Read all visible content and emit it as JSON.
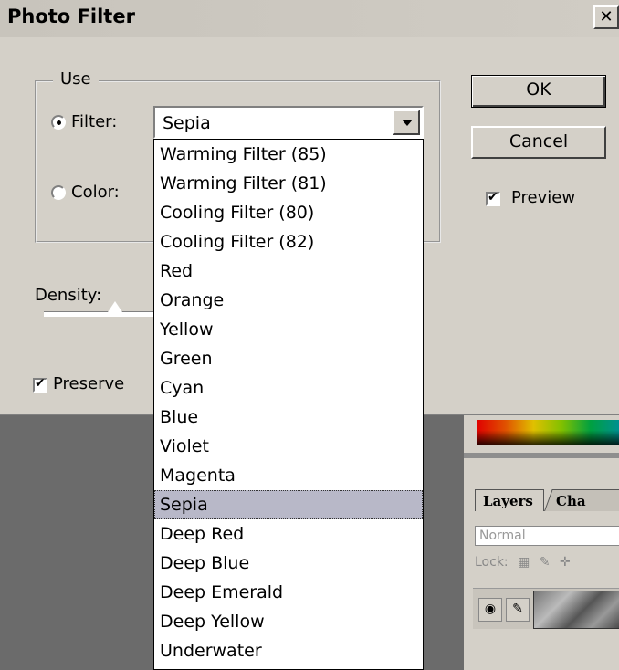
{
  "dialog": {
    "title": "Photo Filter",
    "close_glyph": "✕",
    "use_group_label": "Use",
    "filter_label": "Filter:",
    "color_label": "Color:",
    "selected_filter": "Sepia",
    "density_label": "Density:",
    "preserve_label": "Preserve",
    "ok_label": "OK",
    "cancel_label": "Cancel",
    "preview_label": "Preview",
    "filter_radio_checked": true,
    "preview_checked": true,
    "preserve_checked": true
  },
  "filter_options": [
    "Warming Filter (85)",
    "Warming Filter (81)",
    "Cooling Filter (80)",
    "Cooling Filter (82)",
    "Red",
    "Orange",
    "Yellow",
    "Green",
    "Cyan",
    "Blue",
    "Violet",
    "Magenta",
    "Sepia",
    "Deep Red",
    "Deep Blue",
    "Deep Emerald",
    "Deep Yellow",
    "Underwater"
  ],
  "highlighted_option": "Sepia",
  "layers_panel": {
    "tab_layers": "Layers",
    "tab_channels": "Cha",
    "blend_mode": "Normal",
    "lock_label": "Lock:"
  },
  "colors": {
    "dialog_bg": "#d4d0c8",
    "workspace_bg": "#6b6b6b",
    "highlight": "#b8b8c8"
  }
}
